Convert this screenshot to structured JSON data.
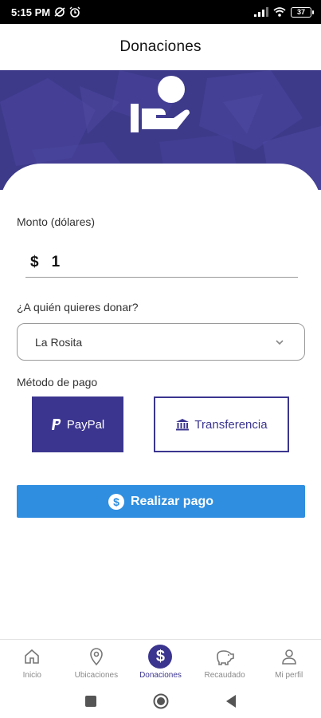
{
  "status_bar": {
    "time": "5:15 PM",
    "battery": "37"
  },
  "header": {
    "title": "Donaciones"
  },
  "banner": {
    "icon": "donation-hand-icon",
    "background_color": "#3e3a8a"
  },
  "form": {
    "amount_label": "Monto (dólares)",
    "currency_symbol": "$",
    "amount_value": "1",
    "recipient_label": "¿A quién quieres donar?",
    "recipient_selected": "La Rosita",
    "method_label": "Método de pago",
    "methods": [
      {
        "label": "PayPal",
        "icon": "paypal-icon",
        "selected": true
      },
      {
        "label": "Transferencia",
        "icon": "bank-icon",
        "selected": false
      }
    ],
    "submit_label": "Realizar pago",
    "submit_icon": "dollar-circle-icon"
  },
  "colors": {
    "primary": "#3b358f",
    "button_blue": "#2f8ee0"
  },
  "bottom_nav": [
    {
      "label": "Inicio",
      "icon": "home-icon",
      "active": false
    },
    {
      "label": "Ubicaciones",
      "icon": "location-pin-icon",
      "active": false
    },
    {
      "label": "Donaciones",
      "icon": "dollar-icon",
      "active": true
    },
    {
      "label": "Recaudado",
      "icon": "piggy-bank-icon",
      "active": false
    },
    {
      "label": "Mi perfil",
      "icon": "user-icon",
      "active": false
    }
  ]
}
